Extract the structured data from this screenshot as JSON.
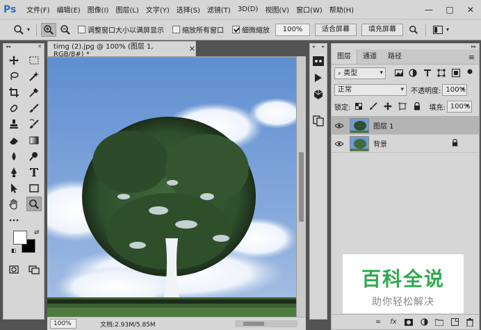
{
  "app": {
    "logo": "Ps"
  },
  "menu": [
    "文件(F)",
    "编辑(E)",
    "图像(I)",
    "图层(L)",
    "文字(Y)",
    "选择(S)",
    "滤镜(T)",
    "3D(D)",
    "视图(V)",
    "窗口(W)",
    "帮助(H)"
  ],
  "window_controls": {
    "minimize": "—",
    "maximize": "□",
    "close": "✕"
  },
  "options": {
    "resize_windows_label": "调整窗口大小以满屏显示",
    "resize_windows_checked": false,
    "zoom_all_label": "缩放所有窗口",
    "zoom_all_checked": false,
    "scrubby_zoom_label": "细微缩放",
    "scrubby_zoom_checked": true,
    "zoom_value": "100%",
    "fit_screen_label": "适合屏幕",
    "fill_screen_label": "填充屏幕"
  },
  "document": {
    "tab_title": "timg (2).jpg @ 100% (图层 1, RGB/8#) *",
    "zoom": "100%",
    "doc_info": "文档:2.93M/5.85M"
  },
  "colors": {
    "foreground": "#ffffff",
    "background": "#000000"
  },
  "layers_panel": {
    "tabs": [
      "图层",
      "通道",
      "路径"
    ],
    "active_tab": "图层",
    "filter_type": "类型",
    "blend_mode": "正常",
    "opacity_label": "不透明度:",
    "opacity_value": "100%",
    "lock_label": "锁定:",
    "fill_label": "填充:",
    "fill_value": "100%",
    "layers": [
      {
        "name": "图层 1",
        "visible": true,
        "selected": true,
        "locked": false
      },
      {
        "name": "背景",
        "visible": true,
        "selected": false,
        "locked": true
      }
    ]
  },
  "watermark": {
    "title": "百科全说",
    "subtitle": "助你轻松解决"
  }
}
